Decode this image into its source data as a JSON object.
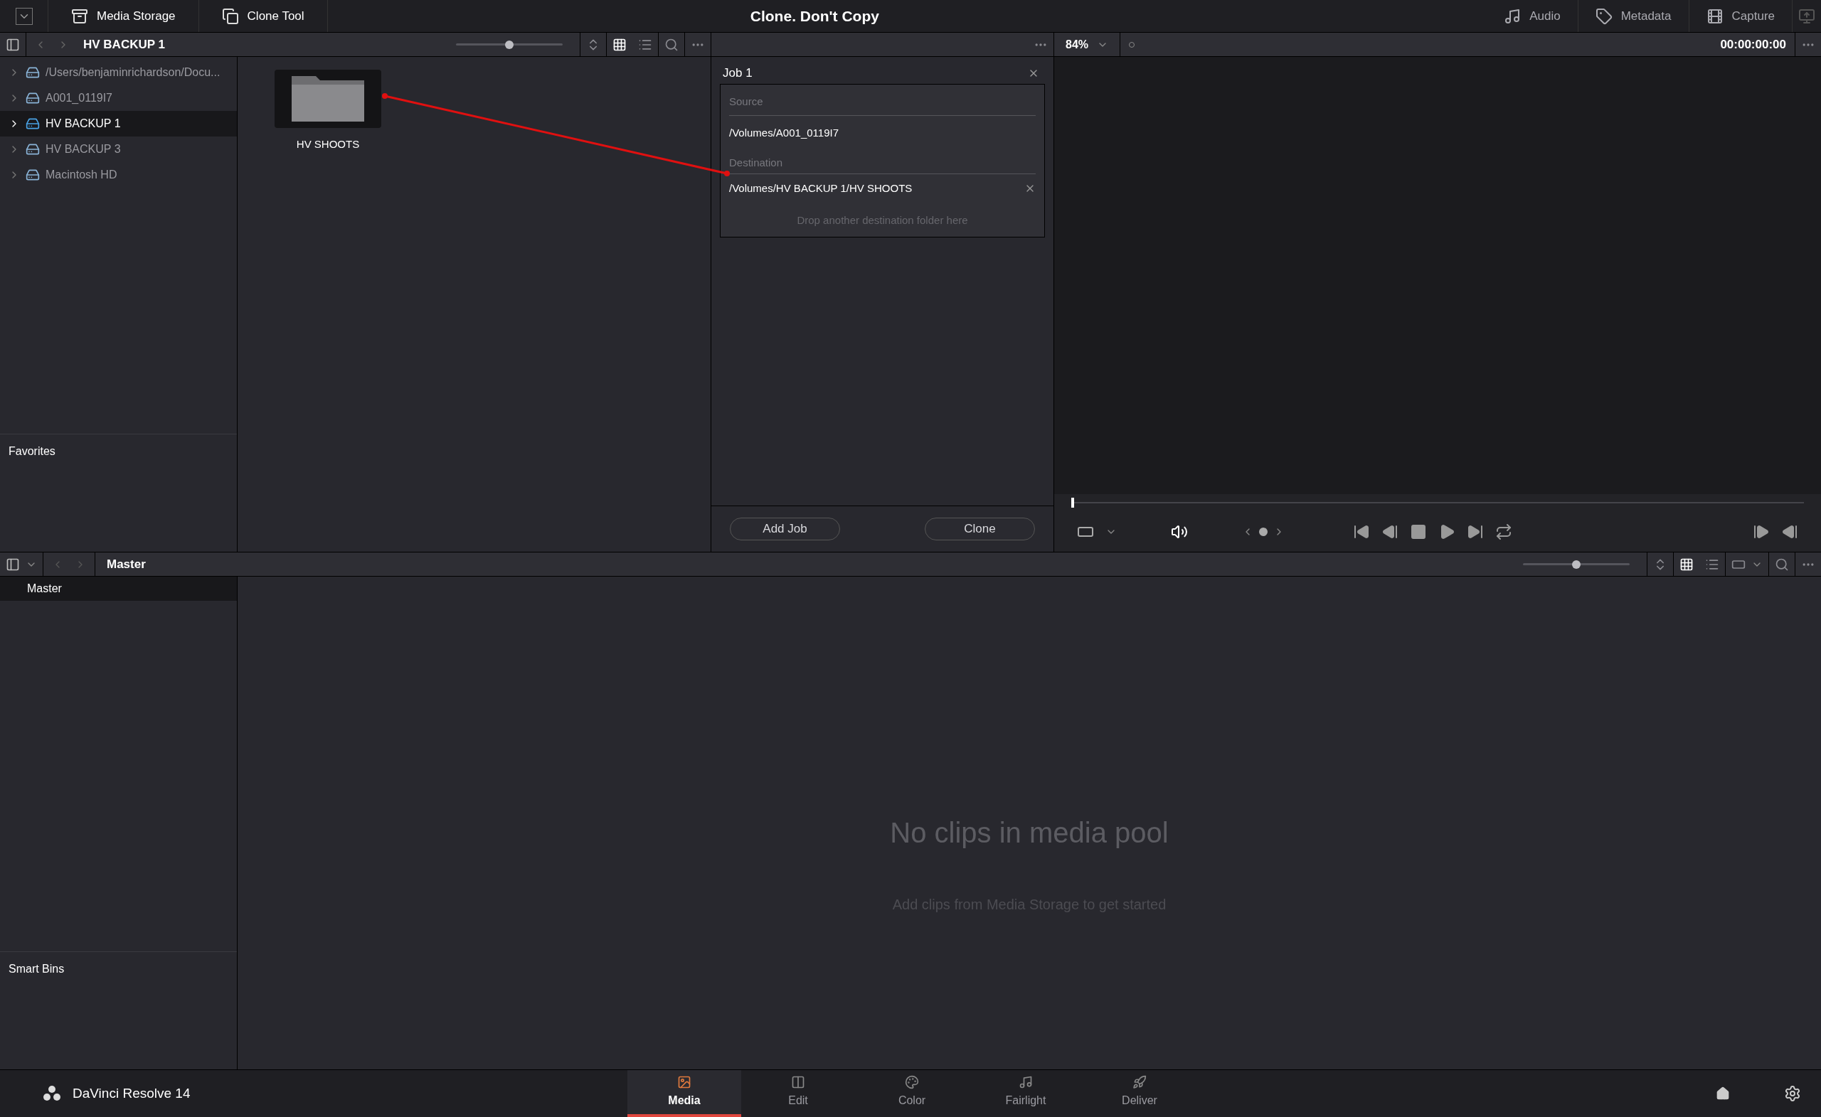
{
  "top_bar": {
    "tools": [
      {
        "kind": "storage",
        "label": "Media Storage"
      },
      {
        "kind": "clone",
        "label": "Clone Tool"
      }
    ],
    "title": "Clone. Don't Copy",
    "panels": [
      {
        "kind": "audio",
        "label": "Audio"
      },
      {
        "kind": "metadata",
        "label": "Metadata"
      },
      {
        "kind": "capture",
        "label": "Capture"
      }
    ]
  },
  "storage": {
    "path": "HV BACKUP 1",
    "slider": {
      "level": 0.5
    },
    "volumes": [
      {
        "name": "/Users/benjaminrichardson/Docu...",
        "selected": false
      },
      {
        "name": "A001_0119I7",
        "selected": false
      },
      {
        "name": "HV BACKUP 1",
        "selected": true
      },
      {
        "name": "HV BACKUP 3",
        "selected": false
      },
      {
        "name": "Macintosh HD",
        "selected": false
      }
    ],
    "favorites": "Favorites",
    "folders": [
      {
        "name": "HV SHOOTS"
      }
    ]
  },
  "clone": {
    "job": "Job 1",
    "source_label": "Source",
    "source": "/Volumes/A001_0119I7",
    "destination_label": "Destination",
    "destinations": [
      "/Volumes/HV BACKUP 1/HV SHOOTS"
    ],
    "drop_hint": "Drop another destination folder here",
    "buttons": [
      "Add Job",
      "Clone"
    ]
  },
  "viewer": {
    "zoom": "84%",
    "timecode": "00:00:00:00",
    "scrubber": {
      "level": 0
    }
  },
  "media_pool": {
    "bin": "Master",
    "bins": [
      {
        "name": "Master",
        "selected": true
      }
    ],
    "smart_bins": "Smart Bins",
    "slider": {
      "level": 0.5
    },
    "empty_title": "No clips in media pool",
    "empty_hint": "Add clips from Media Storage to get started"
  },
  "footer": {
    "app": "DaVinci Resolve 14",
    "pages": [
      {
        "kind": "media",
        "label": "Media",
        "selected": true
      },
      {
        "kind": "edit",
        "label": "Edit",
        "selected": false
      },
      {
        "kind": "color",
        "label": "Color",
        "selected": false
      },
      {
        "kind": "fairlight",
        "label": "Fairlight",
        "selected": false
      },
      {
        "kind": "deliver",
        "label": "Deliver",
        "selected": false
      }
    ]
  }
}
